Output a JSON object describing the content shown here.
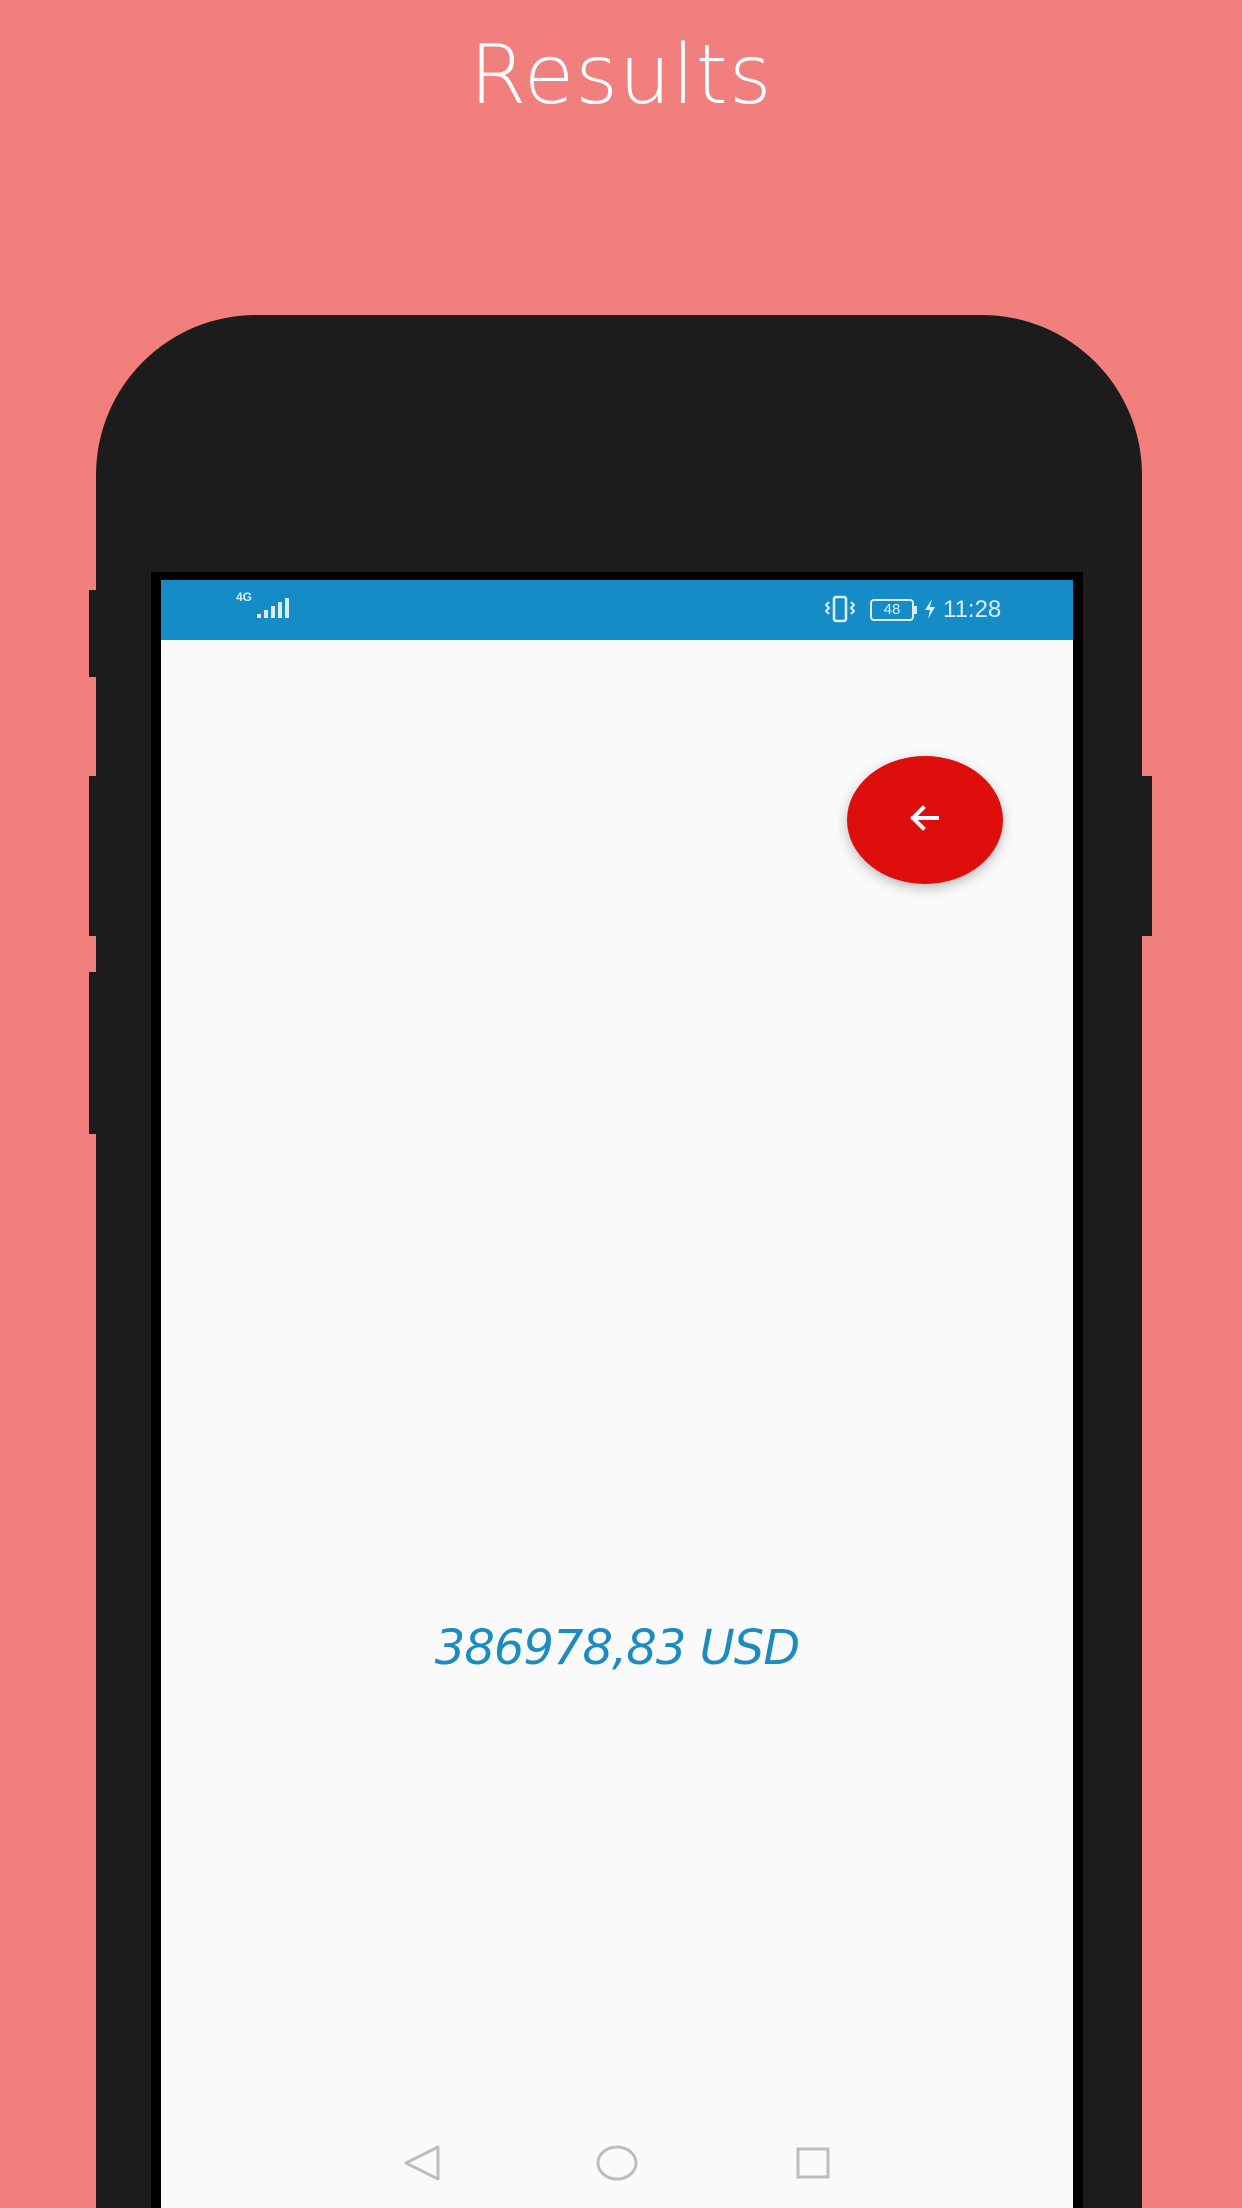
{
  "promo": {
    "title": "Results"
  },
  "status_bar": {
    "network": "4G",
    "battery_level": "48",
    "time": "11:28",
    "icons": [
      "signal-icon",
      "vibrate-icon",
      "battery-icon",
      "charging-bolt-icon"
    ]
  },
  "actions": {
    "back_icon": "arrow-left-icon"
  },
  "result": {
    "value": "386978,83 USD"
  },
  "navigation": {
    "icons": [
      "nav-back-icon",
      "nav-home-icon",
      "nav-recent-apps-icon"
    ]
  },
  "colors": {
    "background": "#f07f7d",
    "status_bar": "#158cc6",
    "accent": "#de0e0c",
    "result_text": "#1c8bc0"
  }
}
